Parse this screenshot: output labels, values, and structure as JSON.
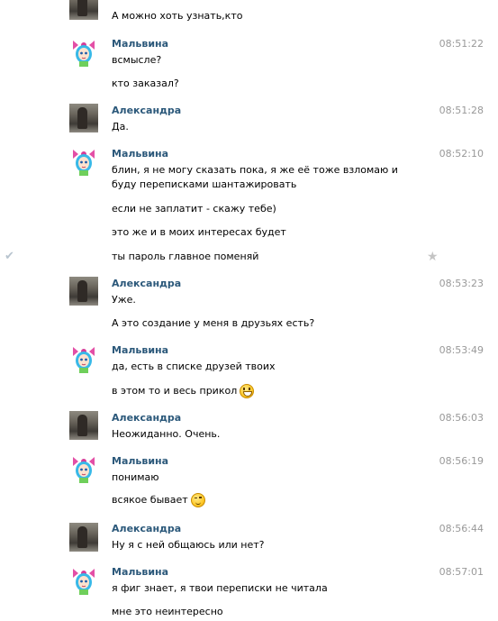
{
  "messages": [
    {
      "text": "А можно хоть узнать,кто"
    },
    {
      "sender": "Мальвина",
      "time": "08:51:22",
      "lines": [
        "всмысле?",
        "кто заказал?"
      ]
    },
    {
      "sender": "Александра",
      "time": "08:51:28",
      "lines": [
        "Да."
      ]
    },
    {
      "sender": "Мальвина",
      "time": "08:52:10",
      "lines": [
        "блин, я не могу сказать пока, я же её тоже взломаю и буду переписками шантажировать",
        "если не заплатит - скажу тебе)",
        "это же и в моих интересах будет",
        "ты пароль главное поменяй"
      ]
    },
    {
      "sender": "Александра",
      "time": "08:53:23",
      "lines": [
        "Уже.",
        "А это создание у меня в друзьях есть?"
      ]
    },
    {
      "sender": "Мальвина",
      "time": "08:53:49",
      "lines": [
        "да, есть в списке друзей твоих",
        "в этом то и весь прикол"
      ]
    },
    {
      "sender": "Александра",
      "time": "08:56:03",
      "lines": [
        "Неожиданно. Очень."
      ]
    },
    {
      "sender": "Мальвина",
      "time": "08:56:19",
      "lines": [
        "понимаю",
        "всякое бывает"
      ]
    },
    {
      "sender": "Александра",
      "time": "08:56:44",
      "lines": [
        "Ну я с ней общаюсь или нет?"
      ]
    },
    {
      "sender": "Мальвина",
      "time": "08:57:01",
      "lines": [
        "я фиг знает, я твои переписки не читала",
        "мне это неинтересно"
      ]
    }
  ],
  "icons": {
    "check": "check-icon",
    "star": "star-icon",
    "emoji_grin": "grinning-face-icon",
    "emoji_wink": "winking-face-icon"
  },
  "colors": {
    "sender": "#2b587a",
    "time": "#999999"
  }
}
